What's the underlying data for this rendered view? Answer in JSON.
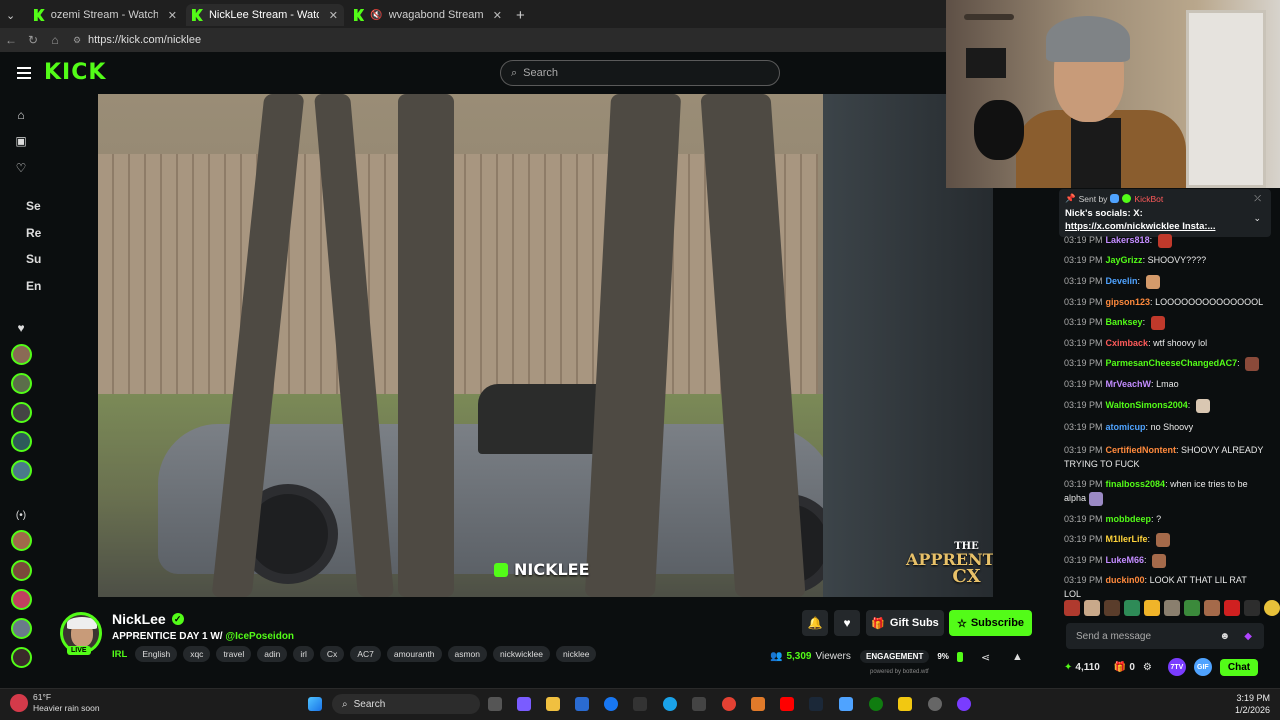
{
  "browser": {
    "tabs": [
      {
        "label": "ozemi Stream - Watch Live on Kick",
        "active": false
      },
      {
        "label": "NickLee Stream - Watch Live on Ki",
        "active": true
      },
      {
        "label": "wvagabond Stream - Watch L",
        "active": false
      }
    ],
    "url": "https://kick.com/nicklee"
  },
  "header": {
    "logo": "KICK",
    "search_placeholder": "Search"
  },
  "sidebar": {
    "labels": [
      "Se",
      "Re",
      "Su",
      "En"
    ]
  },
  "video": {
    "overlay_name": "NICKLEE",
    "apprentice_lines": [
      "THE",
      "APPRENTICE",
      "CX"
    ]
  },
  "chat": {
    "pinned": {
      "sent_by_label": "Sent by",
      "sent_by_user": "KickBot",
      "message_line1": "Nick's socials: X:",
      "message_line2": "https://x.com/nickwicklee Insta:..."
    },
    "messages": [
      {
        "time": "03:19 PM",
        "user": "Lakers818",
        "text": "",
        "color": "#c38cff"
      },
      {
        "time": "03:19 PM",
        "user": "JayGrizz",
        "text": "SHOOVY????",
        "color": "#53fc18"
      },
      {
        "time": "03:19 PM",
        "user": "Develin",
        "text": "",
        "color": "#4fa3ff"
      },
      {
        "time": "03:19 PM",
        "user": "gipson123",
        "text": "LOOOOOOOOOOOOOOL",
        "color": "#ff8a3d"
      },
      {
        "time": "03:19 PM",
        "user": "Banksey",
        "text": "",
        "color": "#53fc18"
      },
      {
        "time": "03:19 PM",
        "user": "Cximback",
        "text": "wtf shoovy lol",
        "color": "#ff5a5a"
      },
      {
        "time": "03:19 PM",
        "user": "ParmesanCheeseChangedAC7",
        "text": "",
        "color": "#53fc18"
      },
      {
        "time": "03:19 PM",
        "user": "MrVeachW",
        "text": "Lmao",
        "color": "#c38cff"
      },
      {
        "time": "03:19 PM",
        "user": "WaltonSimons2004",
        "text": "",
        "color": "#53fc18"
      },
      {
        "time": "03:19 PM",
        "user": "atomicup",
        "text": "no Shoovy",
        "color": "#4fa3ff"
      },
      {
        "time": "03:19 PM",
        "user": "CertifiedNontent",
        "text": "SHOOVY ALREADY TRYING TO FUCK",
        "color": "#ff8a3d"
      },
      {
        "time": "03:19 PM",
        "user": "finalboss2084",
        "text": "when ice tries to be alpha",
        "color": "#53fc18"
      },
      {
        "time": "03:19 PM",
        "user": "mobbdeep",
        "text": "?",
        "color": "#53fc18"
      },
      {
        "time": "03:19 PM",
        "user": "M1llerLife",
        "text": "",
        "color": "#ffd43b"
      },
      {
        "time": "03:19 PM",
        "user": "LukeM66",
        "text": "",
        "color": "#c38cff"
      },
      {
        "time": "03:19 PM",
        "user": "duckin00",
        "text": "LOOK AT THAT LIL RAT LOL",
        "color": "#ff8a3d"
      }
    ],
    "send_placeholder": "Send a message",
    "points": "4,110",
    "gift_count": "0",
    "badge_7tv": "7TV",
    "badge_gif": "GIF",
    "chat_button": "Chat"
  },
  "stream": {
    "name": "NickLee",
    "title_prefix": "APPRENTICE DAY 1 W/",
    "title_mention": "@IcePoseidon",
    "live_label": "LIVE",
    "category": "IRL",
    "tags": [
      "English",
      "xqc",
      "travel",
      "adin",
      "irl",
      "Cx",
      "AC7",
      "amouranth",
      "asmon",
      "nickwicklee",
      "nicklee"
    ],
    "gift_subs_label": "Gift Subs",
    "subscribe_label": "Subscribe",
    "viewers_count": "5,309",
    "viewers_label": "Viewers",
    "engagement_label": "ENGAGEMENT",
    "engagement_value": "9%",
    "powered_by": "powered by botted.wtf"
  },
  "taskbar": {
    "weather_temp": "61°F",
    "weather_text": "Heavier rain soon",
    "search_label": "Search",
    "time": "3:19 PM",
    "date": "1/2/2026"
  },
  "colors": {
    "kick_green": "#53fc18",
    "bg": "#0b0e0f"
  }
}
